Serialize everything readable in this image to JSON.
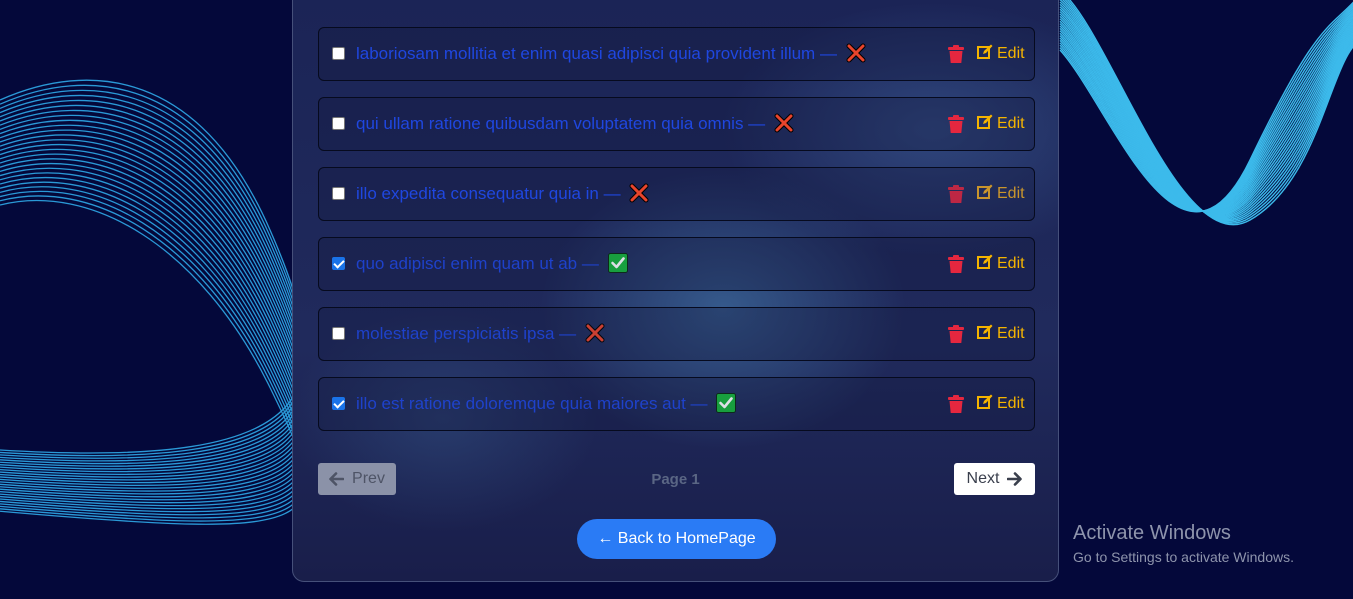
{
  "todos": [
    {
      "title": "laboriosam mollitia et enim quasi adipisci quia provident illum",
      "separator": " — ",
      "completed": false,
      "status_icon": "cross-mark-icon",
      "edit_label": "Edit"
    },
    {
      "title": "qui ullam ratione quibusdam voluptatem quia omnis",
      "separator": " — ",
      "completed": false,
      "status_icon": "cross-mark-icon",
      "edit_label": "Edit"
    },
    {
      "title": "illo expedita consequatur quia in",
      "separator": " — ",
      "completed": false,
      "status_icon": "cross-mark-icon",
      "edit_label": "Edit"
    },
    {
      "title": "quo adipisci enim quam ut ab",
      "separator": " — ",
      "completed": true,
      "status_icon": "check-mark-icon",
      "edit_label": "Edit"
    },
    {
      "title": "molestiae perspiciatis ipsa",
      "separator": " — ",
      "completed": false,
      "status_icon": "cross-mark-icon",
      "edit_label": "Edit"
    },
    {
      "title": "illo est ratione doloremque quia maiores aut",
      "separator": " — ",
      "completed": true,
      "status_icon": "check-mark-icon",
      "edit_label": "Edit"
    }
  ],
  "pagination": {
    "prev_label": "Prev",
    "page_label": "Page 1",
    "next_label": "Next"
  },
  "back_button_label": "← Back to HomePage",
  "watermark": {
    "title": "Activate Windows",
    "subtitle": "Go to Settings to activate Windows."
  },
  "colors": {
    "background": "#04083a",
    "todo_text": "#1f47e0",
    "delete": "#e5273f",
    "edit": "#f5b400",
    "primary_button": "#2a7bf5",
    "wave": "#3fc4f5"
  }
}
